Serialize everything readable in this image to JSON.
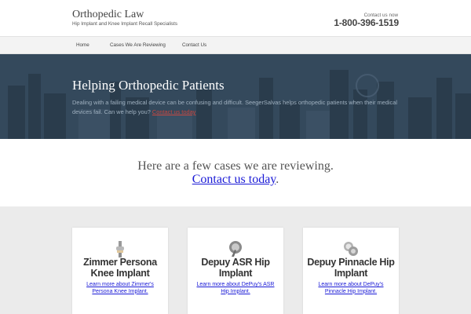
{
  "header": {
    "site_title": "Orthopedic Law",
    "tagline": "Hip Implant and Knee Implant Recall Specialists",
    "contact_label": "Contact us now",
    "phone": "1-800-396-1519"
  },
  "nav": {
    "items": [
      {
        "label": "Home"
      },
      {
        "label": "Cases We Are Reviewing"
      },
      {
        "label": "Contact Us"
      }
    ]
  },
  "hero": {
    "title": "Helping Orthopedic Patients",
    "text": "Dealing with a failing medical device can be confusing and difficult. SeegerSalvas helps orthopedic patients when their medical devices fail. Can we help you?",
    "link_label": "Contact us today"
  },
  "intro": {
    "heading": "Here are a few cases we are reviewing.",
    "link_label": "Contact us today",
    "link_suffix": "."
  },
  "cards": [
    {
      "title": "Zimmer Persona Knee Implant",
      "link": "Learn more about Zimmer's Persona Knee Implant.",
      "icon": "knee-implant-icon"
    },
    {
      "title": "Depuy ASR Hip Implant",
      "link": "Learn more about DePuy's ASR Hip Implant.",
      "icon": "hip-implant-icon"
    },
    {
      "title": "Depuy Pinnacle Hip Implant",
      "link": "Learn more about DePuy's Pinnacle Hip Implant.",
      "icon": "pinnacle-implant-icon"
    }
  ],
  "colors": {
    "link": "#1a1ad6",
    "hero_link": "#c9473f",
    "hero_bg": "#34495c"
  }
}
